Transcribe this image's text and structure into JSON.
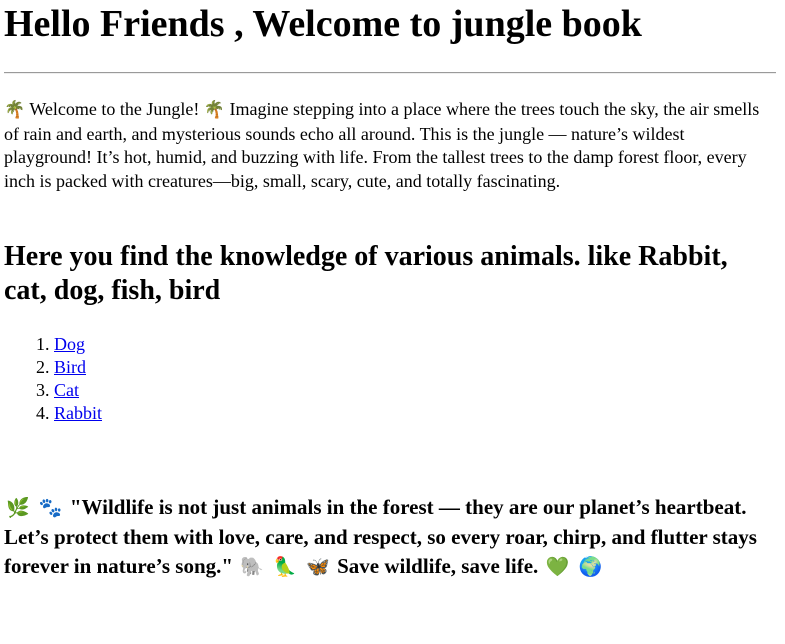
{
  "header": {
    "title": "Hello Friends , Welcome to jungle book"
  },
  "intro": {
    "icon_left": "🌴",
    "welcome": "Welcome to the Jungle!",
    "icon_right": "🌴",
    "text": "Imagine stepping into a place where the trees touch the sky, the air smells of rain and earth, and mysterious sounds echo all around. This is the jungle — nature’s wildest playground! It’s hot, humid, and buzzing with life. From the tallest trees to the damp forest floor, every inch is packed with creatures—big, small, scary, cute, and totally fascinating."
  },
  "subheading": "Here you find the knowledge of various animals. like Rabbit, cat, dog, fish, bird",
  "animals": [
    {
      "label": "Dog"
    },
    {
      "label": "Bird"
    },
    {
      "label": "Cat"
    },
    {
      "label": "Rabbit"
    }
  ],
  "quote": {
    "icons_before": [
      "🌿",
      "🐾"
    ],
    "text": "\"Wildlife is not just animals in the forest — they are our planet’s heartbeat. Let’s protect them with love, care, and respect, so every roar, chirp, and flutter stays forever in nature’s song.\"",
    "icons_middle": [
      "🐘",
      "🦜",
      "🦋"
    ],
    "closing": "Save wildlife, save life.",
    "icons_after": [
      "💚",
      "🌍"
    ]
  },
  "icon_names": {
    "palm": "palm-tree-icon",
    "leaf": "herb-leaf-icon",
    "paws": "paw-prints-icon",
    "elephant": "elephant-icon",
    "parrot": "parrot-icon",
    "butterfly": "butterfly-icon",
    "heart": "green-heart-icon",
    "globe": "globe-icon"
  },
  "colors": {
    "link": "#0000ee",
    "rule": "#9a9a9a",
    "text": "#000000",
    "background": "#ffffff"
  }
}
